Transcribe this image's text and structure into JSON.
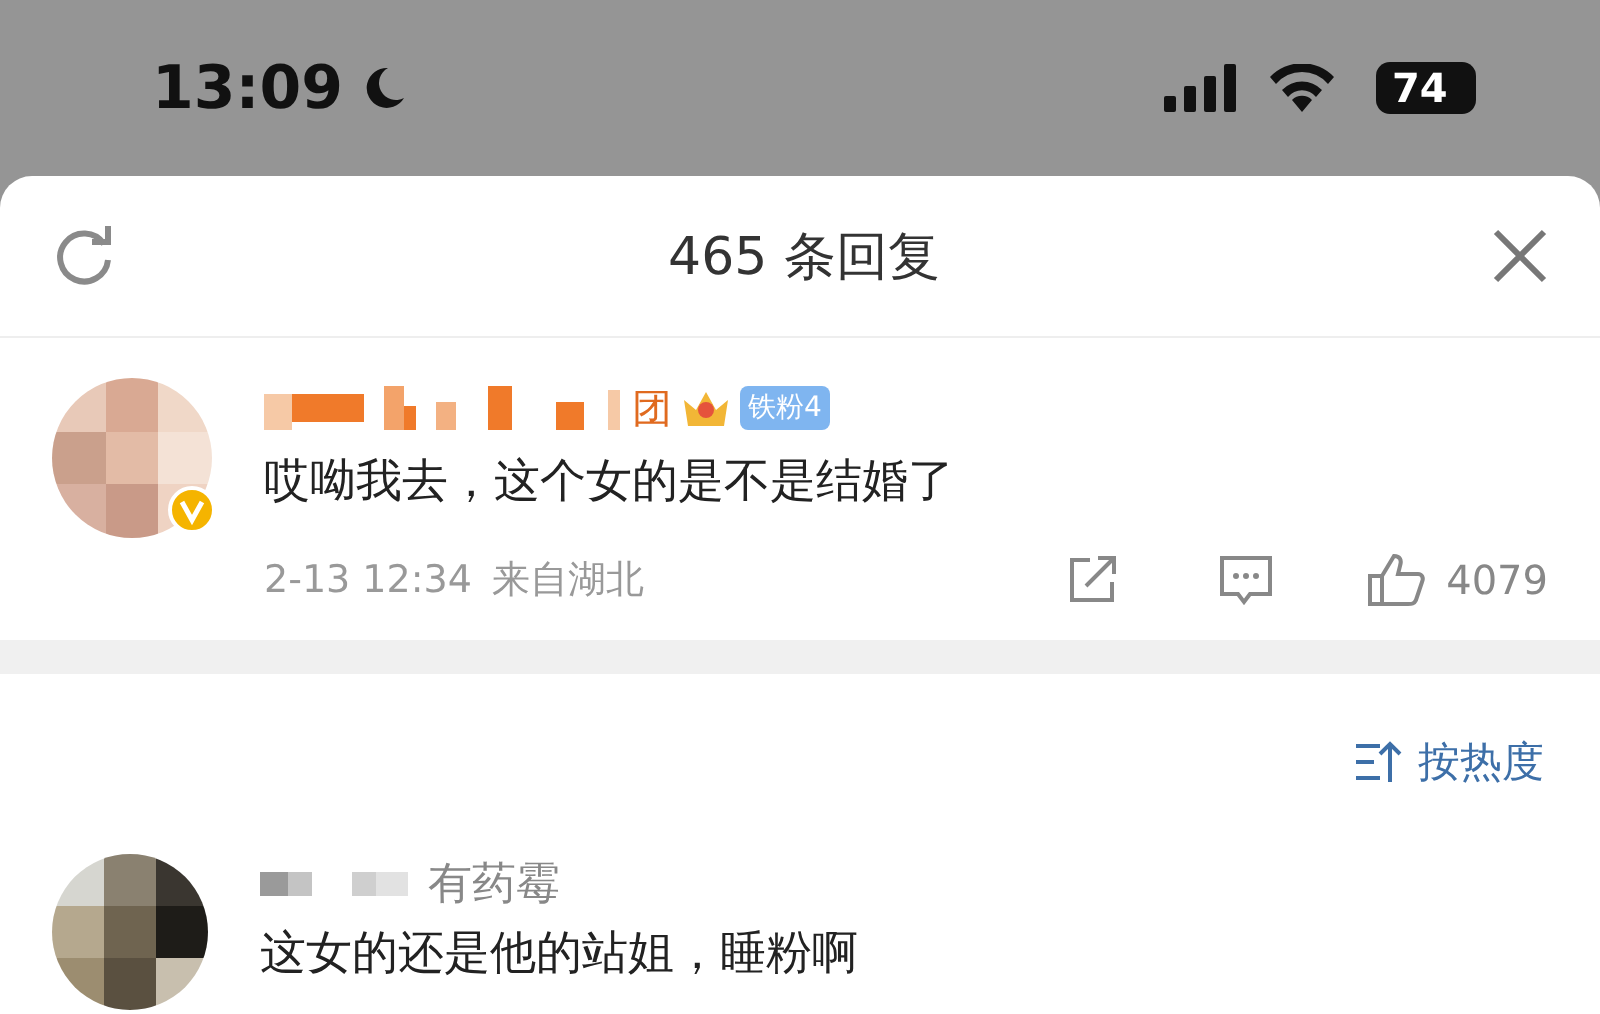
{
  "status_bar": {
    "time": "13:09",
    "battery": "74"
  },
  "sheet": {
    "title": "465 条回复"
  },
  "top_comment": {
    "name_tail": "团",
    "fan_badge": "铁粉4",
    "verified": true,
    "text": "哎呦我去，这个女的是不是结婚了",
    "date": "2-13 12:34",
    "location": "来自湖北",
    "likes": "4079"
  },
  "sort": {
    "label": "按热度"
  },
  "replies": [
    {
      "name_tail": "有药霉",
      "text": "这女的还是他的站姐，睡粉啊"
    }
  ]
}
